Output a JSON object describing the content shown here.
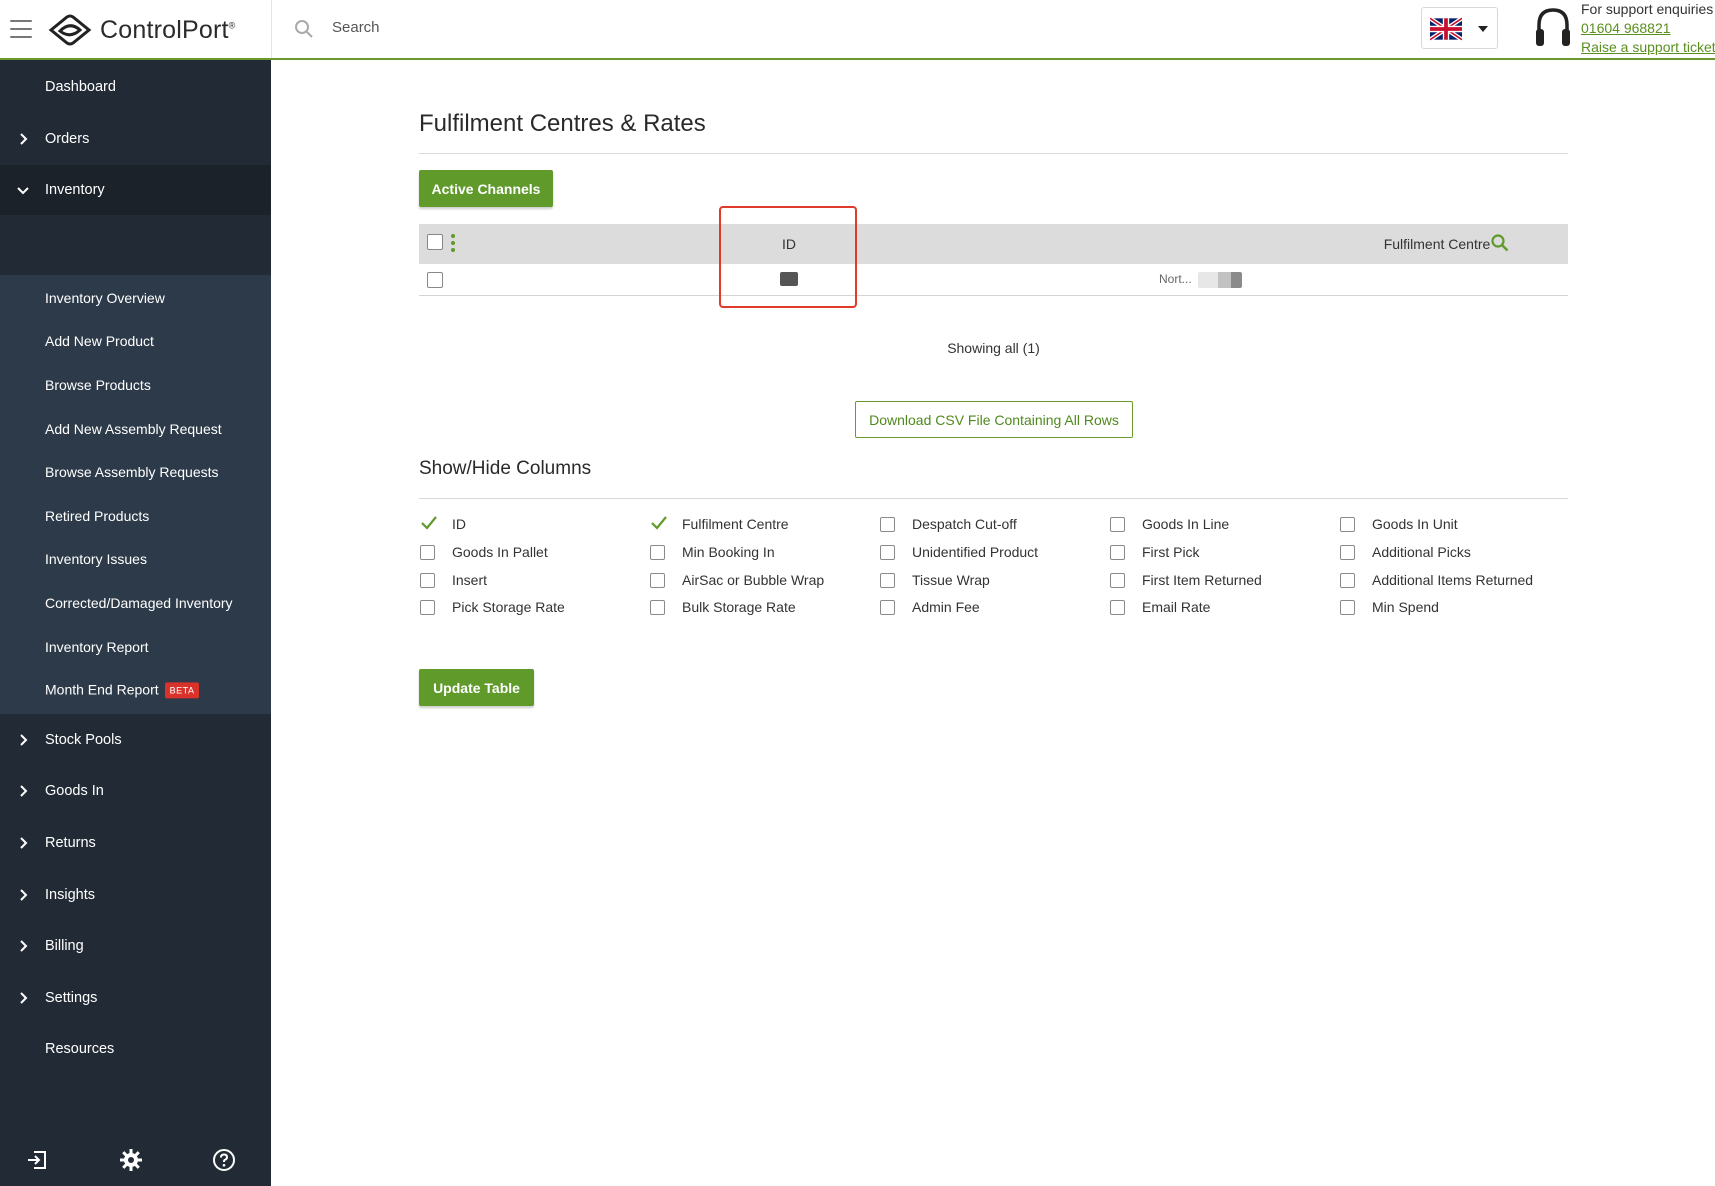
{
  "brand": {
    "name": "ControlPort",
    "mark": "®"
  },
  "search": {
    "placeholder": "Search"
  },
  "support": {
    "title": "For support enquiries",
    "phone": "01604 968821",
    "ticket": "Raise a support ticket"
  },
  "sidebar": {
    "items": [
      {
        "label": "Dashboard",
        "has_chevron": false
      },
      {
        "label": "Orders",
        "has_chevron": true
      },
      {
        "label": "Inventory",
        "has_chevron": true,
        "expanded": true
      },
      {
        "label": "Stock Pools",
        "has_chevron": true
      },
      {
        "label": "Goods In",
        "has_chevron": true
      },
      {
        "label": "Returns",
        "has_chevron": true
      },
      {
        "label": "Insights",
        "has_chevron": true
      },
      {
        "label": "Billing",
        "has_chevron": true
      },
      {
        "label": "Settings",
        "has_chevron": true
      },
      {
        "label": "Resources",
        "has_chevron": false
      }
    ],
    "inventory_submenu": [
      {
        "label": "Inventory Overview"
      },
      {
        "label": "Add New Product"
      },
      {
        "label": "Browse Products"
      },
      {
        "label": "Add New Assembly Request"
      },
      {
        "label": "Browse Assembly Requests"
      },
      {
        "label": "Retired Products"
      },
      {
        "label": "Inventory Issues"
      },
      {
        "label": "Corrected/Damaged Inventory"
      },
      {
        "label": "Inventory Report"
      },
      {
        "label": "Month End Report",
        "badge": "BETA"
      }
    ]
  },
  "main": {
    "title": "Fulfilment Centres & Rates",
    "active_channels_button": "Active Channels",
    "table": {
      "columns": [
        "ID",
        "Fulfilment Centre"
      ],
      "rows": [
        {
          "id": "",
          "fulfilment_centre": "Nort..."
        }
      ]
    },
    "showing": "Showing all (1)",
    "csv_button": "Download CSV File Containing All Rows",
    "show_hide_title": "Show/Hide Columns",
    "column_options": [
      {
        "label": "ID",
        "checked": true
      },
      {
        "label": "Fulfilment Centre",
        "checked": true
      },
      {
        "label": "Despatch Cut-off",
        "checked": false
      },
      {
        "label": "Goods In Line",
        "checked": false
      },
      {
        "label": "Goods In Unit",
        "checked": false
      },
      {
        "label": "Goods In Pallet",
        "checked": false
      },
      {
        "label": "Min Booking In",
        "checked": false
      },
      {
        "label": "Unidentified Product",
        "checked": false
      },
      {
        "label": "First Pick",
        "checked": false
      },
      {
        "label": "Additional Picks",
        "checked": false
      },
      {
        "label": "Insert",
        "checked": false
      },
      {
        "label": "AirSac or Bubble Wrap",
        "checked": false
      },
      {
        "label": "Tissue Wrap",
        "checked": false
      },
      {
        "label": "First Item Returned",
        "checked": false
      },
      {
        "label": "Additional Items Returned",
        "checked": false
      },
      {
        "label": "Pick Storage Rate",
        "checked": false
      },
      {
        "label": "Bulk Storage Rate",
        "checked": false
      },
      {
        "label": "Admin Fee",
        "checked": false
      },
      {
        "label": "Email Rate",
        "checked": false
      },
      {
        "label": "Min Spend",
        "checked": false
      }
    ],
    "update_button": "Update Table"
  },
  "colors": {
    "accent": "#5f9a2a",
    "sidebar_bg": "#222b35",
    "submenu_bg": "#2d3a49",
    "highlight": "#e03a2a",
    "beta_badge": "#d8322b"
  }
}
